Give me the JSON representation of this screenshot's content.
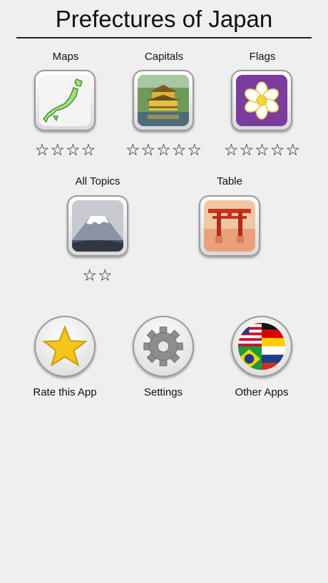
{
  "app": {
    "title": "Prefectures of Japan"
  },
  "topics": [
    {
      "label": "Maps",
      "icon": "japan-map-icon",
      "stars": "☆☆☆☆"
    },
    {
      "label": "Capitals",
      "icon": "golden-pavilion-icon",
      "stars": "☆☆☆☆☆"
    },
    {
      "label": "Flags",
      "icon": "flower-flag-icon",
      "stars": "☆☆☆☆☆"
    },
    {
      "label": "All Topics",
      "icon": "mount-fuji-icon",
      "stars": "☆☆"
    },
    {
      "label": "Table",
      "icon": "torii-gate-icon"
    }
  ],
  "actions": [
    {
      "label": "Rate this App",
      "icon": "star-icon"
    },
    {
      "label": "Settings",
      "icon": "gear-icon"
    },
    {
      "label": "Other Apps",
      "icon": "flags-globe-icon"
    }
  ],
  "colors": {
    "background": "#efefef",
    "flag_purple": "#7b3c9e",
    "star_gold": "#f5c518"
  }
}
